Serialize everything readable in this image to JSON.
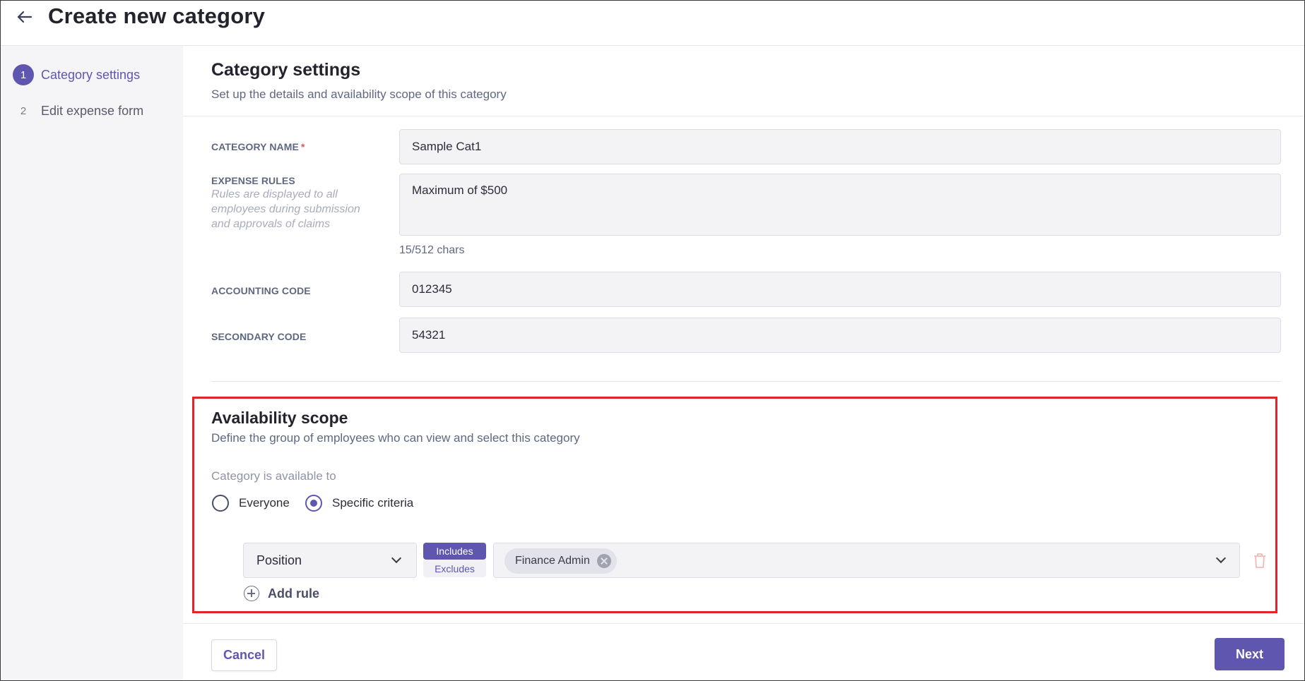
{
  "header": {
    "title": "Create new category",
    "back_icon": "arrow-left-icon"
  },
  "sidebar": {
    "steps": [
      {
        "number": "1",
        "label": "Category settings",
        "active": true
      },
      {
        "number": "2",
        "label": "Edit expense form",
        "active": false
      }
    ]
  },
  "category_settings": {
    "title": "Category settings",
    "subtitle": "Set up the details and availability scope of this category",
    "category_name": {
      "label": "CATEGORY NAME",
      "required_mark": "*",
      "value": "Sample Cat1"
    },
    "expense_rules": {
      "label": "EXPENSE RULES",
      "help": "Rules are displayed to all employees during submission and approvals of claims",
      "value": "Maximum of $500",
      "char_count": "15/512 chars"
    },
    "accounting_code": {
      "label": "ACCOUNTING CODE",
      "value": "012345"
    },
    "secondary_code": {
      "label": "SECONDARY CODE",
      "value": "54321"
    }
  },
  "availability": {
    "title": "Availability scope",
    "subtitle": "Define the group of employees who can view and select this category",
    "available_label": "Category is available to",
    "options": [
      {
        "label": "Everyone",
        "selected": false
      },
      {
        "label": "Specific criteria",
        "selected": true
      }
    ],
    "rule": {
      "field": "Position",
      "include_label": "Includes",
      "exclude_label": "Excludes",
      "mode": "Includes",
      "values": [
        "Finance Admin"
      ]
    },
    "add_rule_label": "Add rule"
  },
  "footer": {
    "cancel_label": "Cancel",
    "next_label": "Next"
  },
  "colors": {
    "accent": "#5f56b0",
    "highlight": "#e0242c",
    "required": "#e05a5a"
  }
}
